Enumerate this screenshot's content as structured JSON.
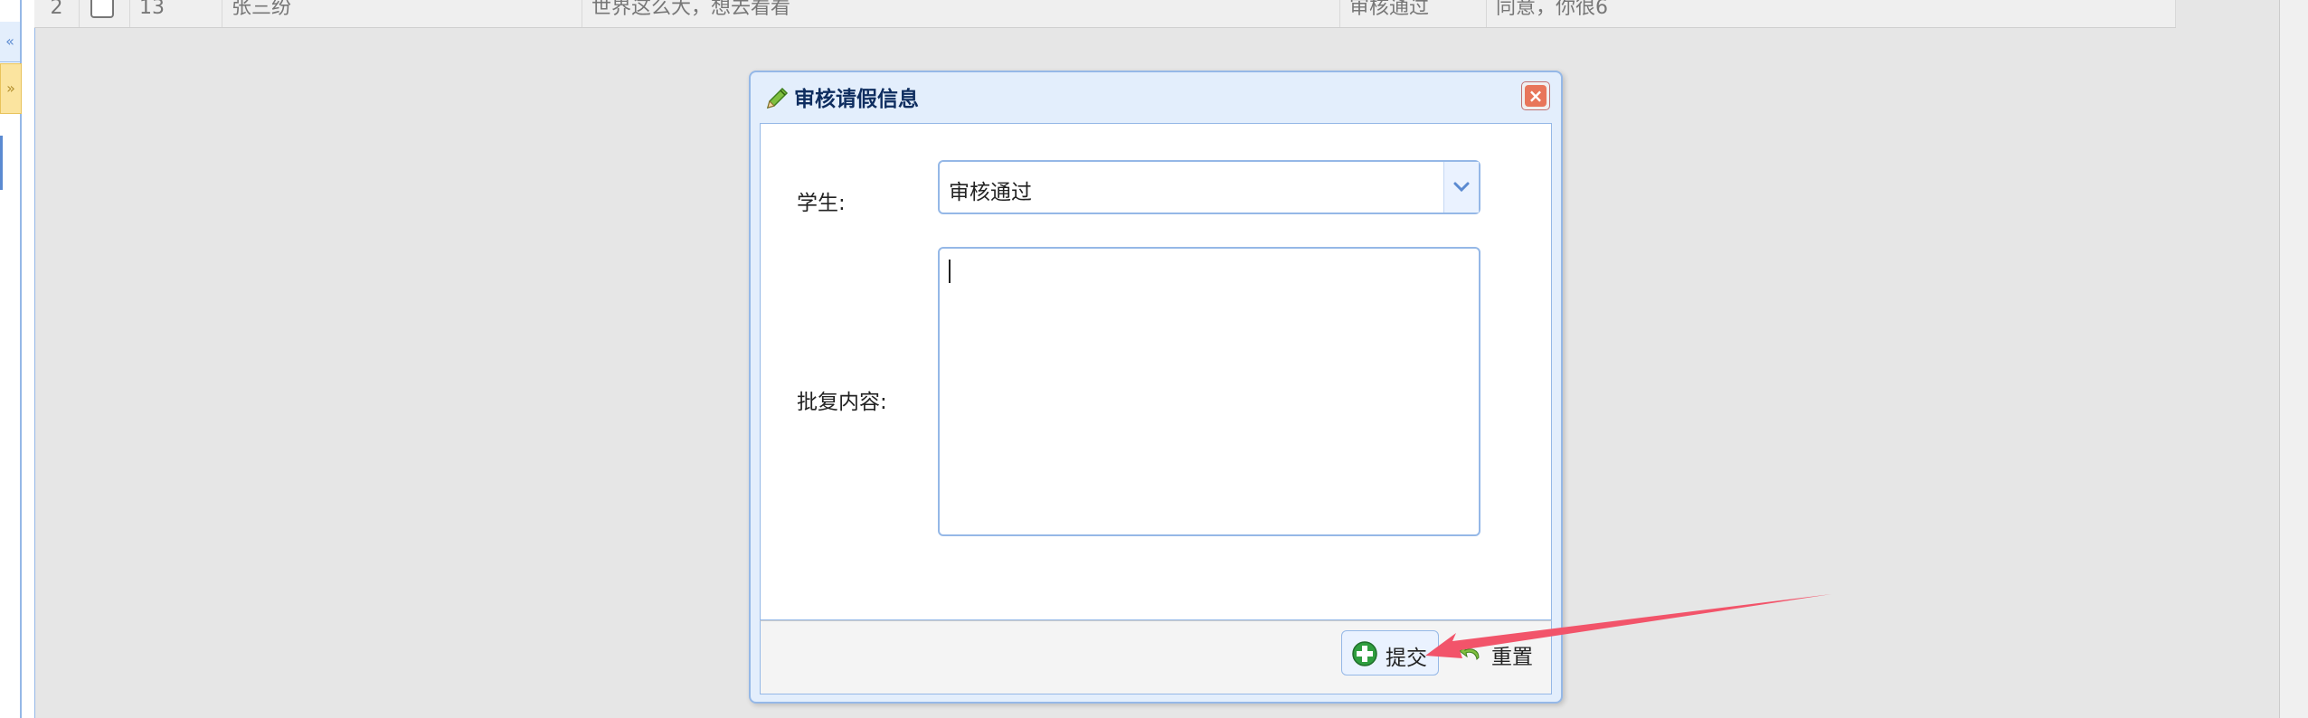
{
  "grid": {
    "row": {
      "number": "2",
      "id": "13",
      "student": "张三纷",
      "reason": "世界这么大，想去看看",
      "status": "审核通过",
      "reply": "同意，你很6"
    }
  },
  "dialog": {
    "title": "审核请假信息",
    "student_label": "学生:",
    "status_select": {
      "value": "审核通过"
    },
    "reply_label": "批复内容:",
    "reply_value": "",
    "submit_label": "提交",
    "reset_label": "重置"
  },
  "icons": {
    "title": "pencil-icon",
    "close": "close-icon",
    "select_arrow": "chevron-down-icon",
    "submit": "plus-icon",
    "reset": "undo-icon"
  },
  "colors": {
    "border": "#95b8e7",
    "header_bg": "#e3eefc",
    "close": "#e8765a",
    "annotation_arrow": "#f2546a"
  }
}
